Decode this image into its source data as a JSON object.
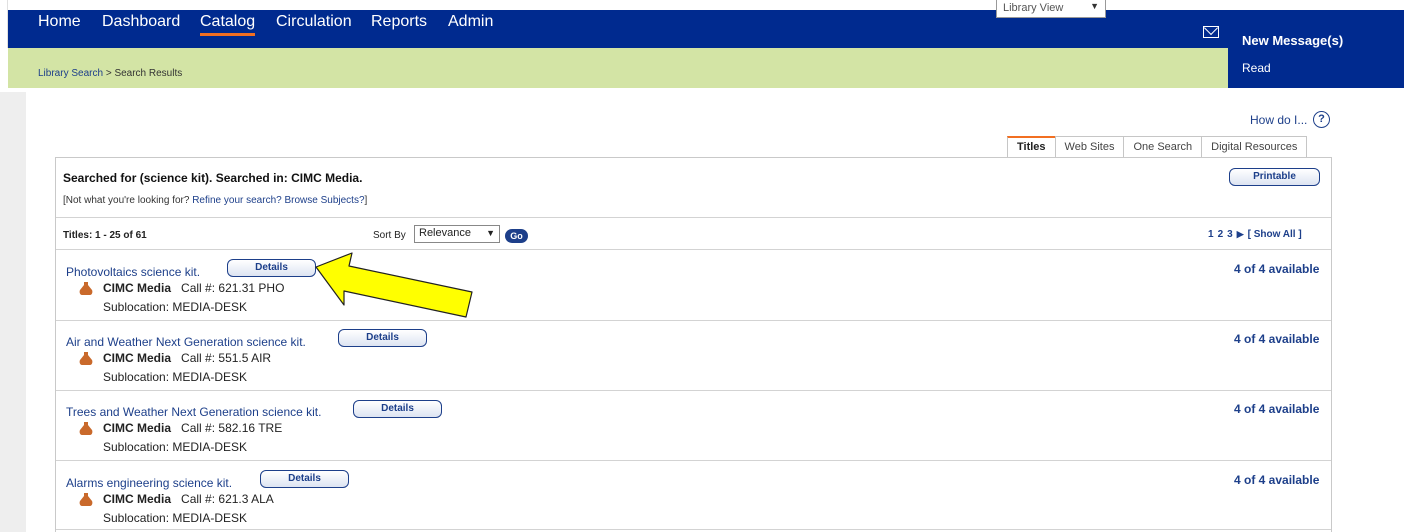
{
  "top": {
    "view_select": "Library View"
  },
  "nav": {
    "items": [
      {
        "label": "Home"
      },
      {
        "label": "Dashboard"
      },
      {
        "label": "Catalog"
      },
      {
        "label": "Circulation"
      },
      {
        "label": "Reports"
      },
      {
        "label": "Admin"
      }
    ],
    "active": "Catalog"
  },
  "breadcrumb": {
    "link": "Library Search",
    "separator": ">",
    "current": "Search Results"
  },
  "messages": {
    "new_label": "New Message(s)",
    "read_label": "Read",
    "icon": "mail-icon"
  },
  "help": {
    "label": "How do I...",
    "icon_glyph": "?"
  },
  "tabs": [
    {
      "label": "Titles"
    },
    {
      "label": "Web Sites"
    },
    {
      "label": "One Search"
    },
    {
      "label": "Digital Resources"
    }
  ],
  "search": {
    "summary": "Searched for (science kit). Searched in: CIMC Media.",
    "refine_prefix": "[Not what you're looking for? ",
    "refine_link": "Refine your search?",
    "browse_link": "Browse Subjects?",
    "refine_suffix": "]",
    "printable_label": "Printable"
  },
  "results_bar": {
    "count_label": "Titles: 1 - 25 of 61",
    "sort_label": "Sort By",
    "sort_value": "Relevance",
    "go_label": "Go",
    "pages": [
      "1",
      "2",
      "3"
    ],
    "show_all": "[ Show All ]"
  },
  "records": [
    {
      "title": "Photovoltaics science kit.",
      "details_label": "Details",
      "location": "CIMC Media",
      "call_label": "Call #:",
      "call_number": "621.31 PHO",
      "sublocation": "Sublocation: MEDIA-DESK",
      "availability": "4 of 4 available"
    },
    {
      "title": "Air and Weather Next Generation science kit.",
      "details_label": "Details",
      "location": "CIMC Media",
      "call_label": "Call #:",
      "call_number": "551.5 AIR",
      "sublocation": "Sublocation: MEDIA-DESK",
      "availability": "4 of 4 available"
    },
    {
      "title": "Trees and Weather Next Generation science kit.",
      "details_label": "Details",
      "location": "CIMC Media",
      "call_label": "Call #:",
      "call_number": "582.16 TRE",
      "sublocation": "Sublocation: MEDIA-DESK",
      "availability": "4 of 4 available"
    },
    {
      "title": "Alarms engineering science kit.",
      "details_label": "Details",
      "location": "CIMC Media",
      "call_label": "Call #:",
      "call_number": "621.3 ALA",
      "sublocation": "Sublocation: MEDIA-DESK",
      "availability": "4 of 4 available"
    }
  ],
  "colors": {
    "nav_blue": "#002a8f",
    "breadcrumb_green": "#d3e4a5",
    "active_tab_orange": "#f26f21",
    "link_blue": "#1d3f8a",
    "annotation_arrow": "#ffff00"
  }
}
